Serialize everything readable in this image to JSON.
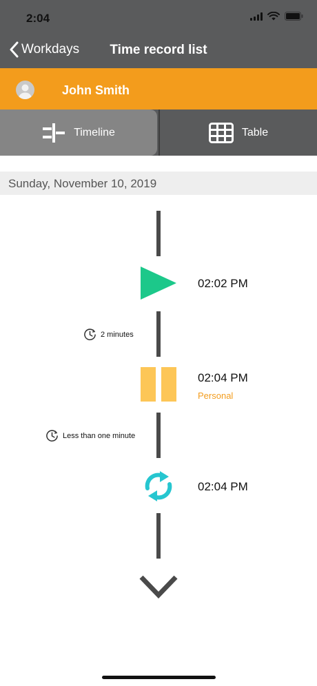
{
  "status_bar": {
    "time": "2:04"
  },
  "nav": {
    "back_label": "Workdays",
    "title": "Time record list"
  },
  "user": {
    "name": "John Smith"
  },
  "tabs": [
    {
      "label": "Timeline",
      "icon": "timeline-icon",
      "active": true
    },
    {
      "label": "Table",
      "icon": "table-grid-icon",
      "active": false
    }
  ],
  "date_header": "Sunday, November 10, 2019",
  "events": [
    {
      "type": "start",
      "icon": "play-icon",
      "time": "02:02 PM",
      "tag": ""
    },
    {
      "type": "pause",
      "icon": "pause-icon",
      "time": "02:04 PM",
      "tag": "Personal"
    },
    {
      "type": "resume",
      "icon": "refresh-icon",
      "time": "02:04 PM",
      "tag": ""
    }
  ],
  "durations": [
    {
      "icon": "clock-icon",
      "text": "2 minutes"
    },
    {
      "icon": "clock-icon",
      "text": "Less than one minute"
    }
  ],
  "colors": {
    "header_bg": "#5a5b5c",
    "accent_orange": "#f39c1c",
    "play_green": "#1cc88a",
    "pause_yellow": "#fdc657",
    "resume_teal": "#26c6d0",
    "timeline_line": "#4a4a4a"
  }
}
